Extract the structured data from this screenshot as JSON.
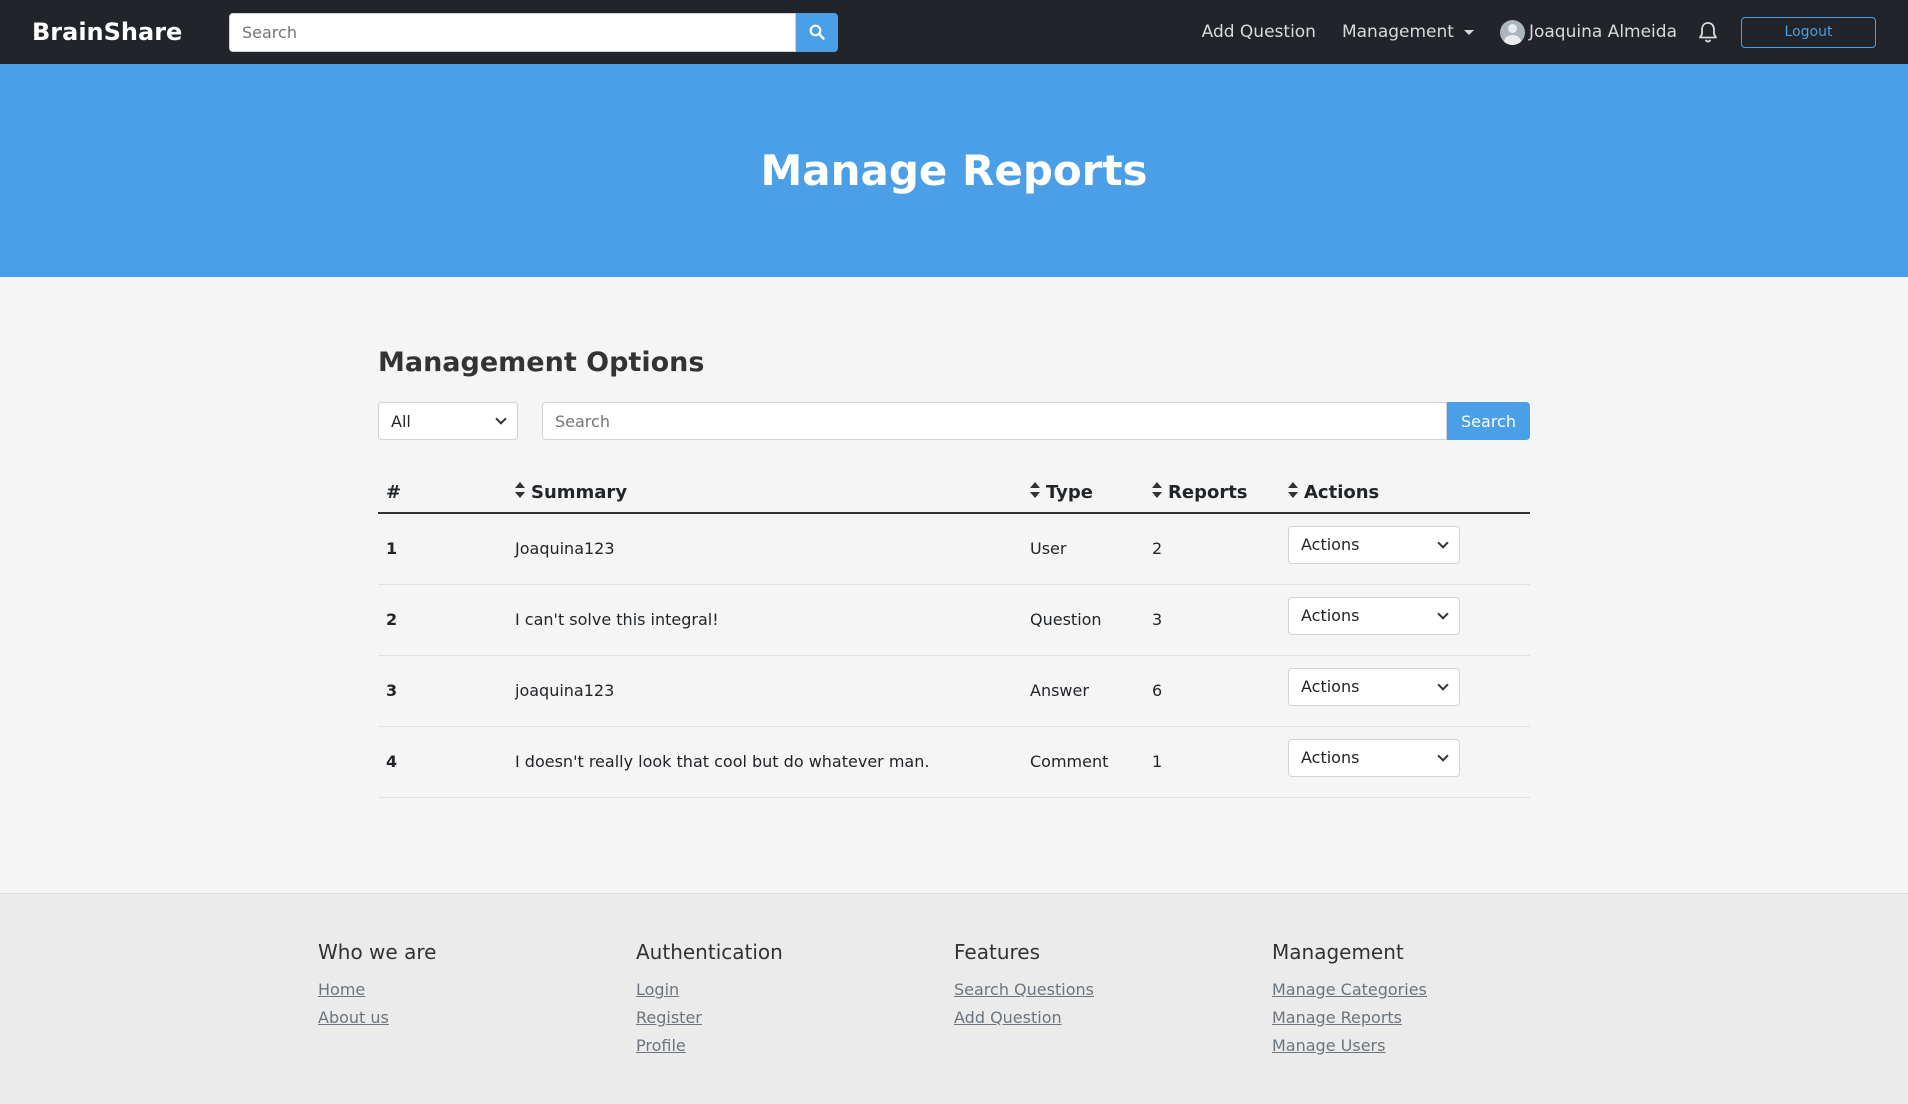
{
  "navbar": {
    "brand": "BrainShare",
    "search_placeholder": "Search",
    "add_question": "Add Question",
    "management": "Management",
    "user_name": "Joaquina Almeida",
    "logout": "Logout"
  },
  "hero": {
    "title": "Manage Reports"
  },
  "main": {
    "heading": "Management Options",
    "filter_value": "All",
    "search_placeholder": "Search",
    "search_button": "Search",
    "columns": {
      "index": "#",
      "summary": "Summary",
      "type": "Type",
      "reports": "Reports",
      "actions": "Actions"
    },
    "rows": [
      {
        "index": "1",
        "summary": "Joaquina123",
        "type": "User",
        "reports": "2",
        "action": "Actions"
      },
      {
        "index": "2",
        "summary": "I can't solve this integral!",
        "type": "Question",
        "reports": "3",
        "action": "Actions"
      },
      {
        "index": "3",
        "summary": "joaquina123",
        "type": "Answer",
        "reports": "6",
        "action": "Actions"
      },
      {
        "index": "4",
        "summary": "I doesn't really look that cool but do whatever man.",
        "type": "Comment",
        "reports": "1",
        "action": "Actions"
      }
    ]
  },
  "footer": {
    "columns": [
      {
        "title": "Who we are",
        "links": [
          "Home",
          "About us"
        ]
      },
      {
        "title": "Authentication",
        "links": [
          "Login",
          "Register",
          "Profile"
        ]
      },
      {
        "title": "Features",
        "links": [
          "Search Questions",
          "Add Question"
        ]
      },
      {
        "title": "Management",
        "links": [
          "Manage Categories",
          "Manage Reports",
          "Manage Users"
        ]
      }
    ]
  },
  "colors": {
    "accent": "#4a9fe7",
    "navbar": "#212529"
  }
}
